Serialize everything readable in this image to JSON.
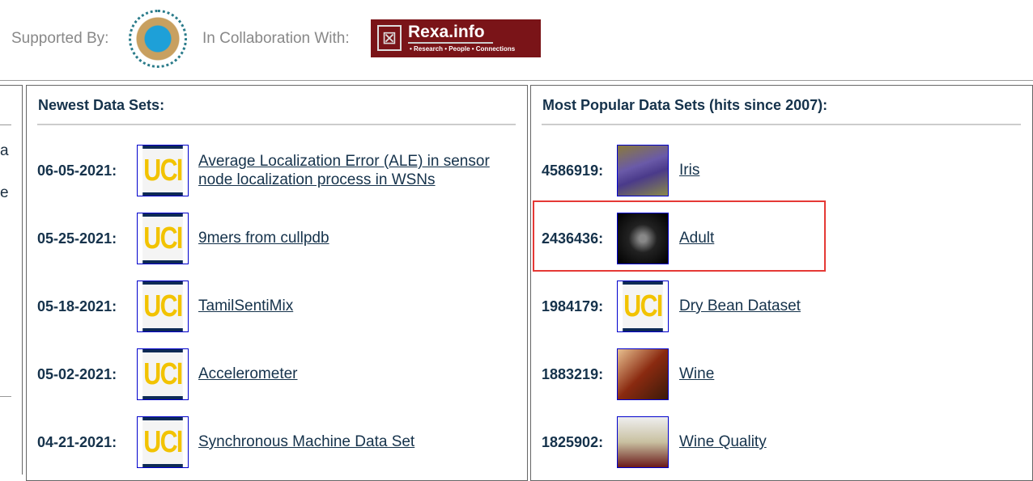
{
  "header": {
    "supported_by": "Supported By:",
    "collaboration": "In Collaboration With:",
    "rexa_name": "Rexa.info",
    "rexa_tagline": "• Research • People • Connections"
  },
  "left_fragments": [
    "a",
    "e"
  ],
  "newest": {
    "title": "Newest Data Sets:",
    "items": [
      {
        "date": "06-05-2021:",
        "name": "Average Localization Error (ALE) in sensor node localization process in WSNs",
        "line1": "Average Localization Error (ALE) in sensor",
        "line2": "node localization process in WSNs",
        "thumb": "UCI"
      },
      {
        "date": "05-25-2021:",
        "name": "9mers from cullpdb",
        "thumb": "UCI"
      },
      {
        "date": "05-18-2021:",
        "name": "TamilSentiMix",
        "thumb": "UCI"
      },
      {
        "date": "05-02-2021:",
        "name": "Accelerometer",
        "thumb": "UCI"
      },
      {
        "date": "04-21-2021:",
        "name": "Synchronous Machine Data Set",
        "thumb": "UCI"
      }
    ]
  },
  "popular": {
    "title": "Most Popular Data Sets (hits since 2007):",
    "items": [
      {
        "hits": "4586919:",
        "name": "Iris",
        "thumb": "iris-photo"
      },
      {
        "hits": "2436436:",
        "name": "Adult",
        "thumb": "us-map-photo",
        "highlighted": true
      },
      {
        "hits": "1984179:",
        "name": "Dry Bean Dataset",
        "thumb": "UCI"
      },
      {
        "hits": "1883219:",
        "name": "Wine",
        "thumb": "wine-photo"
      },
      {
        "hits": "1825902:",
        "name": "Wine Quality",
        "thumb": "wine-glasses-photo"
      }
    ]
  },
  "colors": {
    "text": "#15324b",
    "highlight": "#e53935",
    "rexa": "#7a1418",
    "uci_yellow": "#f2c300"
  }
}
